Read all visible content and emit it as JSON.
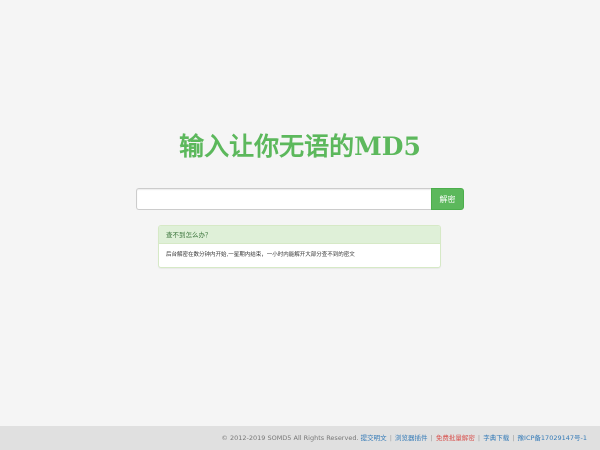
{
  "main": {
    "title": "输入让你无语的MD5",
    "search": {
      "value": "",
      "placeholder": ""
    },
    "decode_button_label": "解密",
    "help_panel": {
      "heading": "查不到怎么办？",
      "body": "后台解密在数分钟内开始,一星期内结束，一小时内能解开大部分查不到的密文"
    }
  },
  "footer": {
    "copyright": "© 2012-2019 SOMD5 All Rights Reserved.",
    "links": [
      {
        "label": "提交明文"
      },
      {
        "label": "浏览器插件"
      },
      {
        "label": "免费批量解密"
      },
      {
        "label": "字典下载"
      },
      {
        "label": "豫ICP备17029147号-1"
      }
    ],
    "separator": "|"
  },
  "colors": {
    "accent": "#5cb85c",
    "link": "#337ab7",
    "highlight_link": "#d9534f",
    "page_background": "#f5f5f5",
    "footer_background": "#e0e0e0"
  }
}
